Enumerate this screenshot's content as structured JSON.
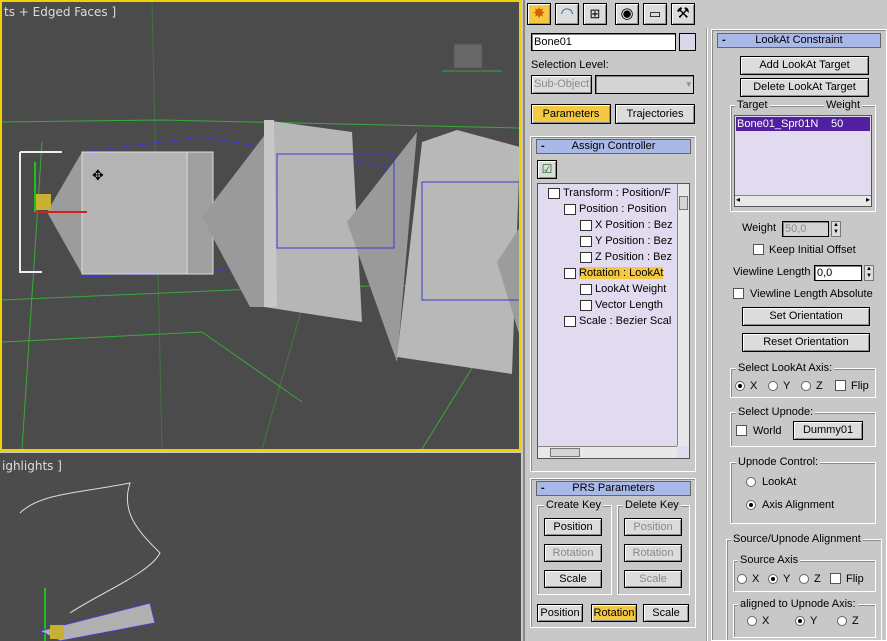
{
  "viewports": {
    "top_label": "ts + Edged Faces ]",
    "bottom_label": "ighlights ]"
  },
  "tabs": [
    {
      "icon": "create-star-icon"
    },
    {
      "icon": "modify-bend-icon"
    },
    {
      "icon": "hierarchy-icon"
    },
    {
      "icon": "motion-icon"
    },
    {
      "icon": "display-monitor-icon"
    },
    {
      "icon": "utilities-hammer-icon"
    }
  ],
  "object": {
    "name": "Bone01",
    "color": "#d8d8ea"
  },
  "selection": {
    "label": "Selection Level:",
    "subobject": "Sub-Object"
  },
  "motion_tabs": {
    "parameters": "Parameters",
    "trajectories": "Trajectories"
  },
  "assign": {
    "header": "Assign Controller",
    "minus": "-",
    "tree": [
      {
        "text": "Transform : Position/F",
        "indent": 0,
        "highlight": false
      },
      {
        "text": "Position : Position",
        "indent": 1,
        "highlight": false
      },
      {
        "text": "X Position : Bez",
        "indent": 2,
        "highlight": false
      },
      {
        "text": "Y Position : Bez",
        "indent": 2,
        "highlight": false
      },
      {
        "text": "Z Position : Bez",
        "indent": 2,
        "highlight": false
      },
      {
        "text": "Rotation : LookAt",
        "indent": 1,
        "highlight": true
      },
      {
        "text": "LookAt Weight",
        "indent": 2,
        "highlight": false
      },
      {
        "text": "Vector Length",
        "indent": 2,
        "highlight": false
      },
      {
        "text": "Scale : Bezier Scal",
        "indent": 1,
        "highlight": false
      }
    ]
  },
  "prs": {
    "header": "PRS Parameters",
    "create_key": "Create Key",
    "delete_key": "Delete Key",
    "position": "Position",
    "rotation": "Rotation",
    "scale": "Scale"
  },
  "bottom_buttons": {
    "position": "Position",
    "rotation": "Rotation",
    "scale": "Scale"
  },
  "lookat": {
    "header": "LookAt Constraint",
    "add_target": "Add LookAt Target",
    "delete_target": "Delete LookAt Target",
    "col_target": "Target",
    "col_weight": "Weight",
    "target_name": "Bone01_Spr01N",
    "target_weight": "50",
    "weight_label": "Weight",
    "weight_value": "50,0",
    "keep_offset": "Keep Initial Offset",
    "viewline_label": "Viewline Length",
    "viewline_value": "0,0",
    "viewline_abs": "Viewline Length Absolute",
    "set_orientation": "Set Orientation",
    "reset_orientation": "Reset Orientation",
    "axis_label": "Select LookAt Axis:",
    "x": "X",
    "y": "Y",
    "z": "Z",
    "flip": "Flip",
    "upnode_label": "Select Upnode:",
    "world": "World",
    "upnode_obj": "Dummy01",
    "upnode_control": "Upnode Control:",
    "lookat_opt": "LookAt",
    "axis_alignment": "Axis Alignment",
    "source_upnode": "Source/Upnode Alignment",
    "source_axis": "Source Axis",
    "aligned_label": "aligned to Upnode Axis:"
  }
}
